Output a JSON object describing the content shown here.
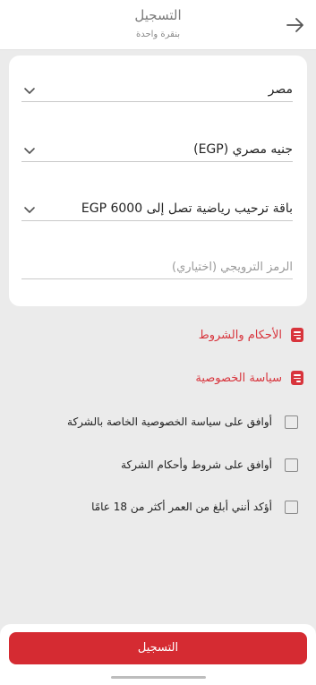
{
  "header": {
    "title": "التسجيل",
    "subtitle": "بنقرة واحدة",
    "back_icon": "arrow-right-icon"
  },
  "form": {
    "country": {
      "value": "مصر",
      "icon": "chevron-down-icon"
    },
    "currency": {
      "value": "جنيه مصري (EGP)",
      "icon": "chevron-down-icon"
    },
    "bonus": {
      "value": "باقة ترحيب رياضية تصل إلى EGP 6000",
      "icon": "chevron-down-icon"
    },
    "promo": {
      "placeholder": "الرمز الترويجي (اختياري)"
    }
  },
  "links": [
    {
      "label": "الأحكام والشروط",
      "icon": "document-icon"
    },
    {
      "label": "سياسة الخصوصية",
      "icon": "document-icon"
    }
  ],
  "checkboxes": [
    {
      "label": "أوافق على سياسة الخصوصية الخاصة بالشركة",
      "checked": false
    },
    {
      "label": "أوافق على شروط وأحكام الشركة",
      "checked": false
    },
    {
      "label": "أؤكد أنني أبلغ من العمر أكثر من 18 عامًا",
      "checked": false
    }
  ],
  "footer": {
    "submit_label": "التسجيل"
  },
  "colors": {
    "accent": "#d52b32",
    "background": "#ebebeb",
    "card": "#ffffff"
  }
}
